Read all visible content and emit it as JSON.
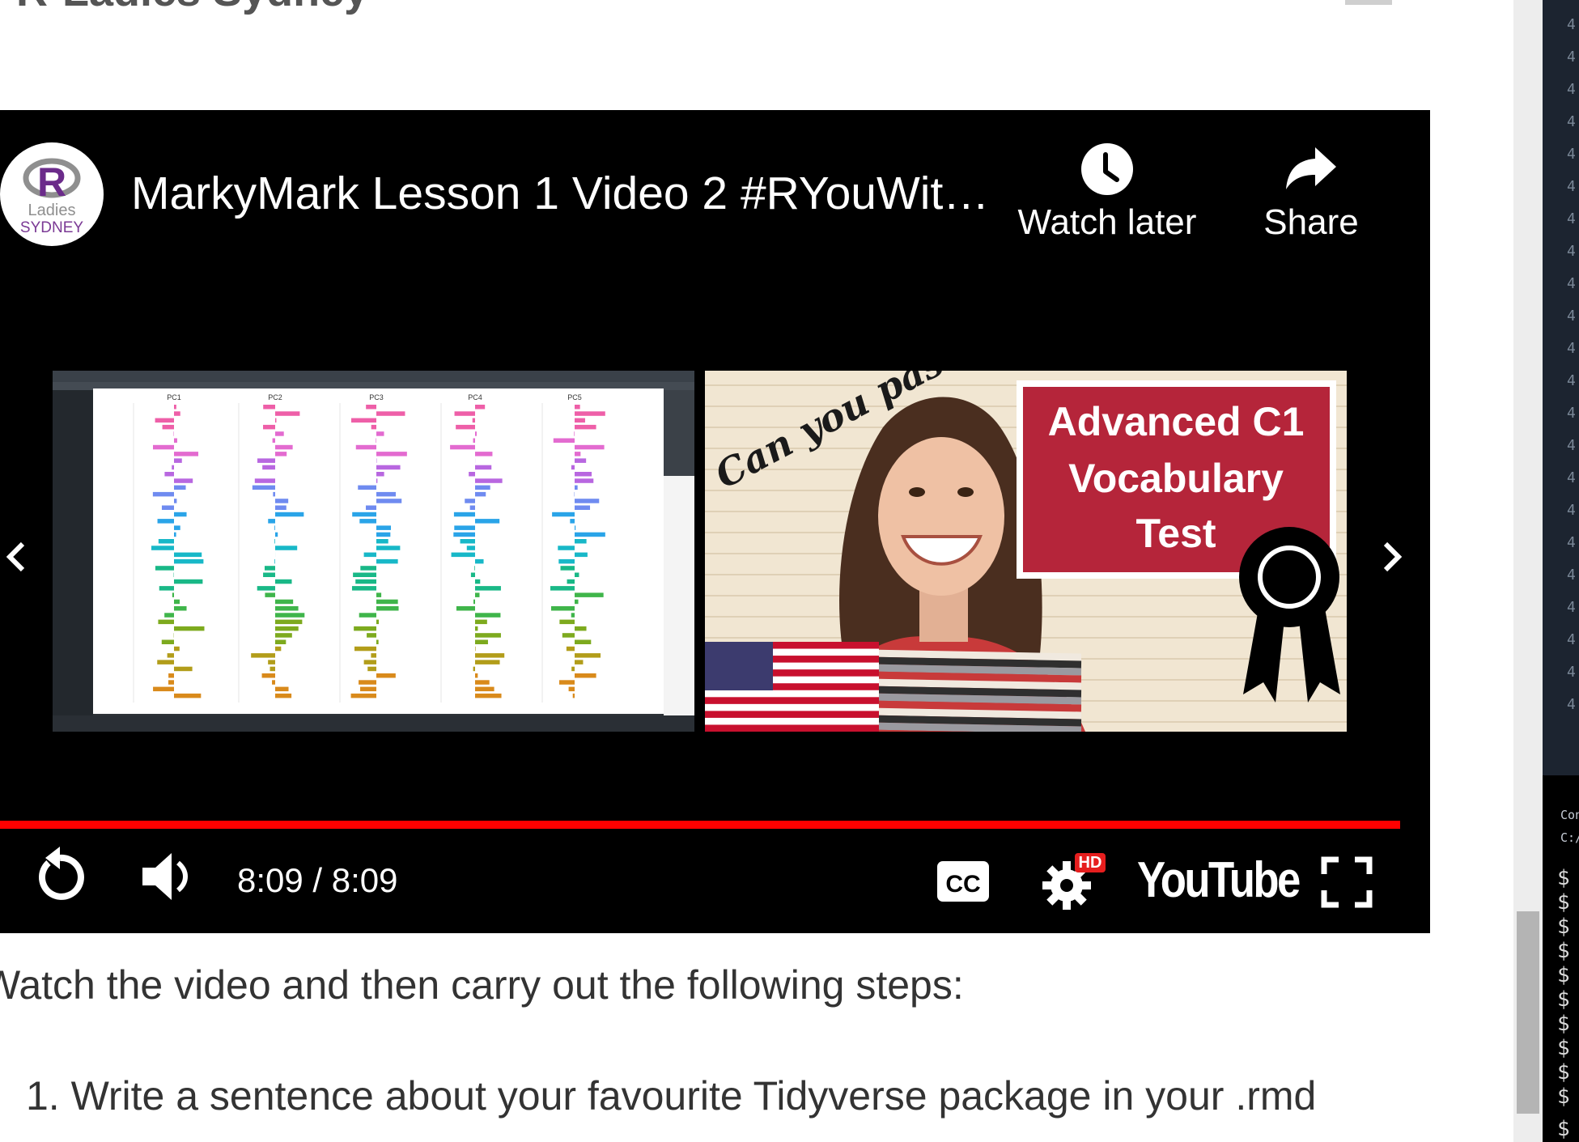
{
  "page": {
    "header_title": "R-Ladies Sydney",
    "intro_text": "Watch the video and then carry out the following steps:",
    "steps": [
      "1. Write a sentence about your favourite Tidyverse package in your .rmd"
    ]
  },
  "player": {
    "channel_logo": {
      "letter": "R",
      "line1": "Ladies",
      "line2": "SYDNEY"
    },
    "title": "MarkyMark Lesson 1 Video 2 #RYouWit…",
    "watch_later_label": "Watch later",
    "share_label": "Share",
    "time": "8:09 / 8:09",
    "progress_fraction": 1.0,
    "hd_badge": "HD",
    "brand": "YouTube",
    "icons": [
      "clock-icon",
      "share-arrow-icon",
      "chevron-left-icon",
      "chevron-right-icon",
      "replay-icon",
      "volume-icon",
      "captions-icon",
      "settings-icon",
      "fullscreen-icon"
    ],
    "colors": {
      "progress": "#ff0000",
      "player_bg": "#000000",
      "hd_badge": "#e61e1e"
    }
  },
  "suggestions": [
    {
      "kind": "rstudio-plot-thumbnail",
      "panel_labels": [
        "PC1",
        "PC2",
        "PC3",
        "PC4",
        "PC5"
      ]
    },
    {
      "kind": "vocabulary-test-thumbnail",
      "script_text": "Can you pass?",
      "banner_lines": [
        "Advanced C1",
        "Vocabulary",
        "Test"
      ]
    }
  ],
  "side_panel": {
    "console_label": "Con",
    "path_label": "C:/"
  }
}
